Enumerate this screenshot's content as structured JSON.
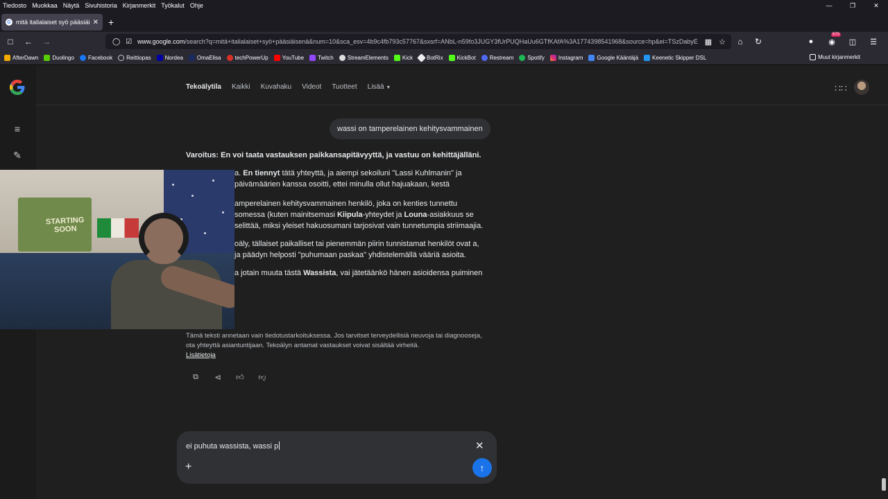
{
  "menubar": {
    "items": [
      "Tiedosto",
      "Muokkaa",
      "Näytä",
      "Sivuhistoria",
      "Kirjanmerkit",
      "Työkalut",
      "Ohje"
    ]
  },
  "tab": {
    "title": "mitä italialaiset syö pääsiäisenä"
  },
  "urlbar": {
    "domain": "www.google.com",
    "path": "/search?q=mitä+italialaiset+syö+pääsiäisenä&num=10&sca_esv=4b9c4fb793c57767&sxsrf=ANbL-n59fo3JUGY3fUrPUQHaUu6GTfKAfA%3A1774398541968&source=hp&ei=TSzDabyE"
  },
  "extension_badge": "570",
  "bookmarks": [
    "AfterDawn",
    "Duolingo",
    "Facebook",
    "Reittiopas",
    "Nordea",
    "OmaElisa",
    "techPowerUp",
    "YouTube",
    "Twitch",
    "StreamElements",
    "Kick",
    "BotRix",
    "KickBot",
    "Restream",
    "Spotify",
    "Instagram",
    "Google Kääntäjä",
    "Keenetic Skipper DSL"
  ],
  "bookmarks_other": "Muut kirjanmerkit",
  "gnav": {
    "ai_mode": "Tekoälytila",
    "all": "Kaikki",
    "images": "Kuvahaku",
    "videos": "Videot",
    "products": "Tuotteet",
    "more": "Lisää"
  },
  "query": "wassi on tamperelainen kehitysvammainen",
  "answer": {
    "warning": "Varoitus: En voi taata vastauksen paikkansapitävyyttä, ja vastuu on kehittäjälläni.",
    "p1_a": "a. ",
    "p1_bold": "En tiennyt",
    "p1_b": " tätä yhteyttä, ja aiempi sekoiluni \"Lassi Kuhlmanin\" ja päivämäärien kanssa osoitti, ettei minulla ollut hajuakaan, kestä",
    "p2_a": "amperelainen kehitysvammainen henkilö, joka on kenties tunnettu somessa (kuten mainitsemasi ",
    "p2_kiipula": "Kiipula",
    "p2_b": "-yhteydet ja ",
    "p2_louna": "Louna",
    "p2_c": "-asiakkuus se selittää, miksi yleiset hakuosumani tarjosivat vain tunnetumpia striimaajia.",
    "p3": "oäly, tällaiset paikalliset tai pienemmän piirin tunnistamat henkilöt ovat a, ja päädyn helposti \"puhumaan paskaa\" yhdistelemällä vääriä asioita.",
    "p4_a": "a jotain muuta tästä ",
    "p4_bold": "Wassista",
    "p4_b": ", vai jätetäänkö hänen asioidensa puiminen"
  },
  "disclaimer": {
    "text": "Tämä teksti annetaan vain tiedotustarkoituksessa. Jos tarvitset terveydellisiä neuvoja tai diagnooseja, ota yhteyttä asiantuntijaan. Tekoälyn antamat vastaukset voivat sisältää virheitä.",
    "link": "Lisätietoja"
  },
  "webcam": {
    "poster_text": "STARTING SOON"
  },
  "input": {
    "value": "ei puhuta wassista, wassi p"
  }
}
